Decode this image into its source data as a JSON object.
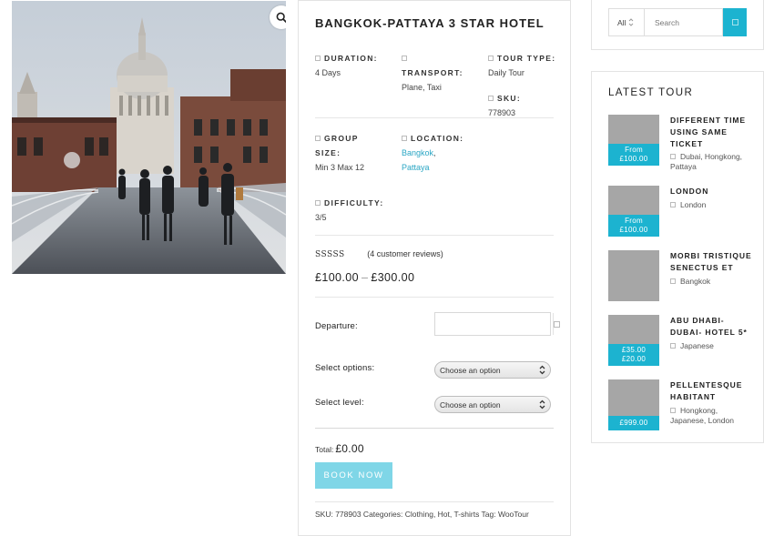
{
  "product": {
    "title": "BANGKOK-PATTAYA 3 STAR HOTEL",
    "duration_label": "DURATION:",
    "duration_value": "4 Days",
    "transport_label": "TRANSPORT:",
    "transport_value": "Plane, Taxi",
    "tour_type_label": "TOUR TYPE:",
    "tour_type_value": "Daily Tour",
    "sku_label": "SKU:",
    "sku_value": "778903",
    "group_label_1": "GROUP",
    "group_label_2": "SIZE:",
    "group_value": "Min 3 Max 12",
    "location_label": "LOCATION:",
    "location_link_1": "Bangkok",
    "location_sep": ",",
    "location_link_2": "Pattaya",
    "difficulty_label": "DIFFICULTY:",
    "difficulty_value": "3/5",
    "stars": "SSSSS",
    "reviews": "(4 customer reviews)",
    "price_from": "£100.00",
    "price_dash": "–",
    "price_to": "£300.00"
  },
  "form": {
    "departure_label": "Departure:",
    "departure_value": "",
    "options_label": "Select options:",
    "options_value": "Choose an option",
    "level_label": "Select level:",
    "level_value": "Choose an option",
    "total_label": "Total:",
    "total_value": "£0.00",
    "book_label": "BOOK NOW"
  },
  "footer_meta": "SKU: 778903 Categories: Clothing, Hot, T-shirts Tag: WooTour",
  "search": {
    "category": "All",
    "placeholder": "Search"
  },
  "latest": {
    "title": "LATEST TOUR",
    "items": [
      {
        "name": "DIFFERENT TIME USING SAME TICKET",
        "badge_1": "From",
        "badge_2": "£100.00",
        "location": "Dubai, Hongkong, Pattaya"
      },
      {
        "name": "LONDON",
        "badge_1": "From",
        "badge_2": "£100.00",
        "location": "London"
      },
      {
        "name": "MORBI TRISTIQUE SENECTUS ET",
        "badge_1": "",
        "badge_2": "",
        "location": "Bangkok"
      },
      {
        "name": "ABU DHABI- DUBAI- HOTEL 5*",
        "badge_1": "£35.00",
        "badge_2": "£20.00",
        "location": "Japanese"
      },
      {
        "name": "PELLENTESQUE HABITANT",
        "badge_1": "",
        "badge_2": "£999.00",
        "location": "Hongkong, Japanese, London"
      }
    ]
  },
  "colors": {
    "accent": "#1cb3d0",
    "book_button": "#7fd6e7",
    "link": "#2aa6c4",
    "thumb": "#a6a6a6"
  },
  "icons": {
    "zoom": "magnifier-icon",
    "calendar": "calendar-icon",
    "search": "search-icon",
    "select": "chevron-updown-icon"
  }
}
